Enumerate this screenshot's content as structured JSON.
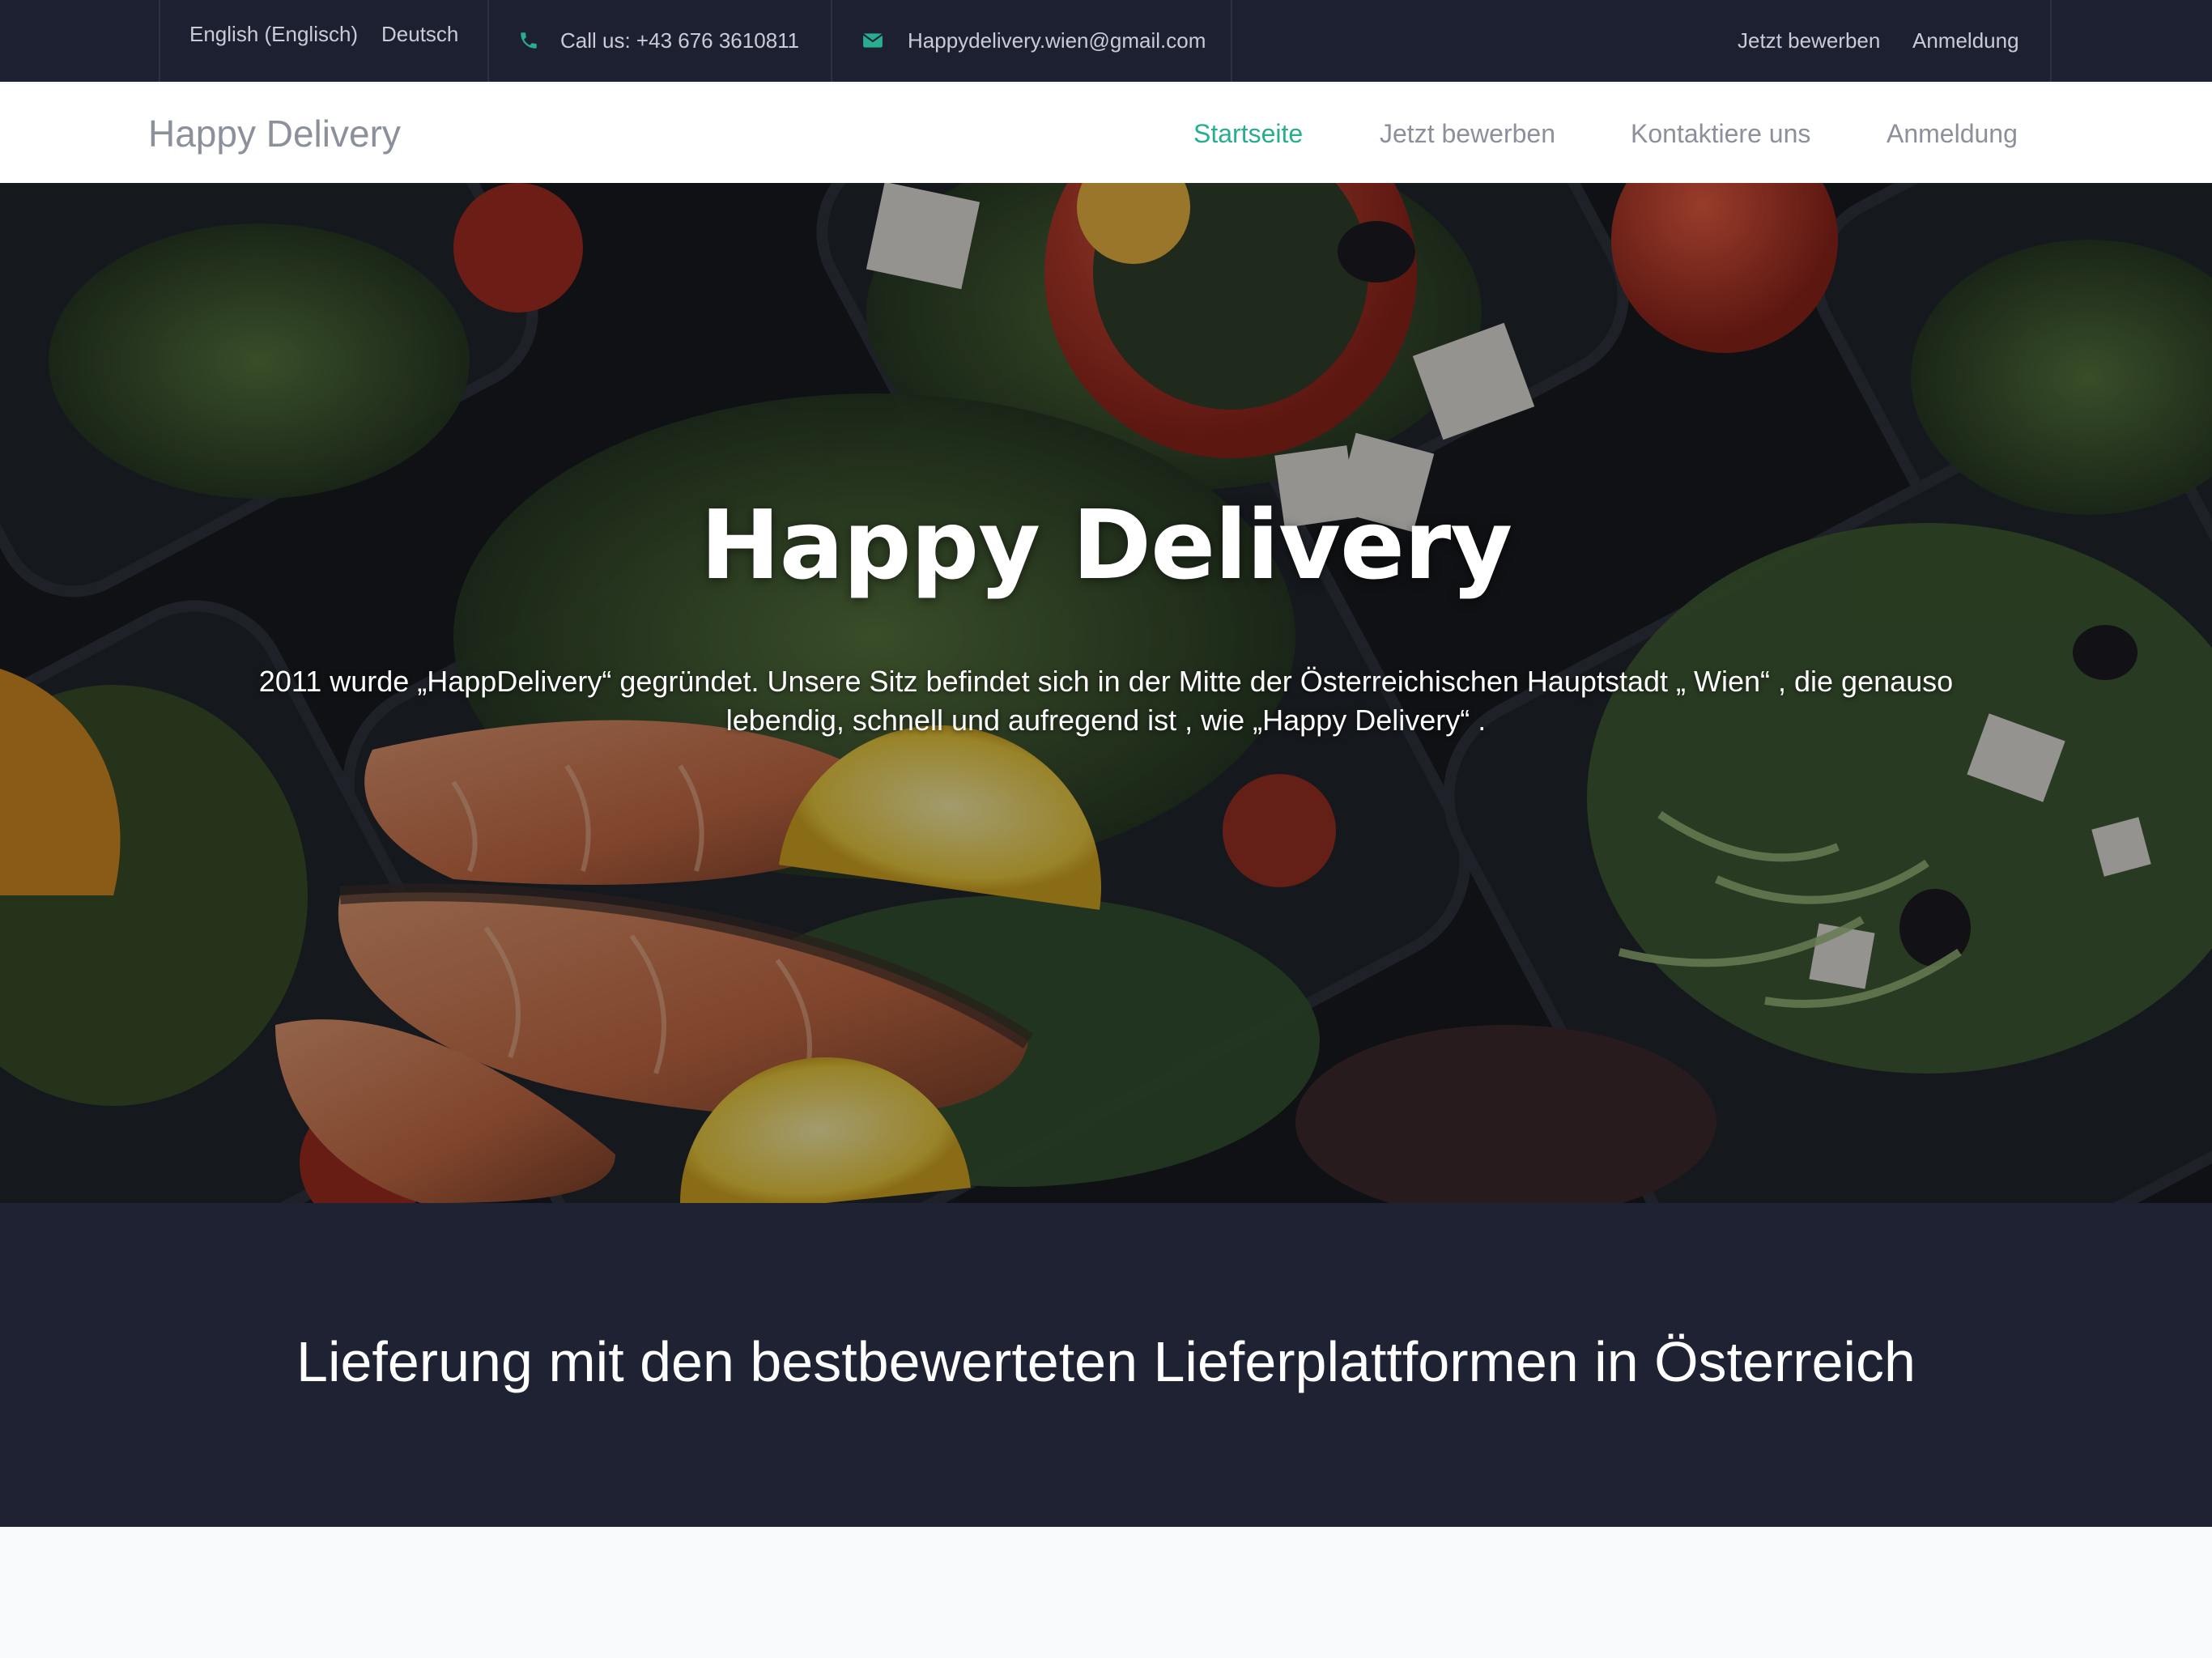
{
  "topbar": {
    "language_english": "English (Englisch)",
    "language_german": "Deutsch",
    "phone_icon": "phone-icon",
    "phone_text": "Call us: +43 676 3610811",
    "email_icon": "envelope-icon",
    "email_text": "Happydelivery.wien@gmail.com",
    "apply_link": "Jetzt bewerben",
    "login_link": "Anmeldung"
  },
  "navbar": {
    "brand": "Happy Delivery",
    "items": [
      {
        "label": "Startseite",
        "active": true
      },
      {
        "label": "Jetzt bewerben",
        "active": false
      },
      {
        "label": "Kontaktiere uns",
        "active": false
      },
      {
        "label": "Anmeldung",
        "active": false
      }
    ]
  },
  "hero": {
    "title": "Happy Delivery",
    "description": "2011 wurde „HappDelivery“ gegründet. Unsere Sitz befindet sich in der Mitte der Österreichischen Hauptstadt „ Wien“ , die genauso lebendig, schnell und aufregend ist , wie „Happy Delivery“ ."
  },
  "band": {
    "heading": "Lieferung mit den bestbewerteten Lieferplattformen in Österreich"
  },
  "colors": {
    "topbar_bg": "#1d2030",
    "accent": "#27ad8f",
    "band_bg": "#1f2233",
    "nav_text": "#8b909b"
  }
}
